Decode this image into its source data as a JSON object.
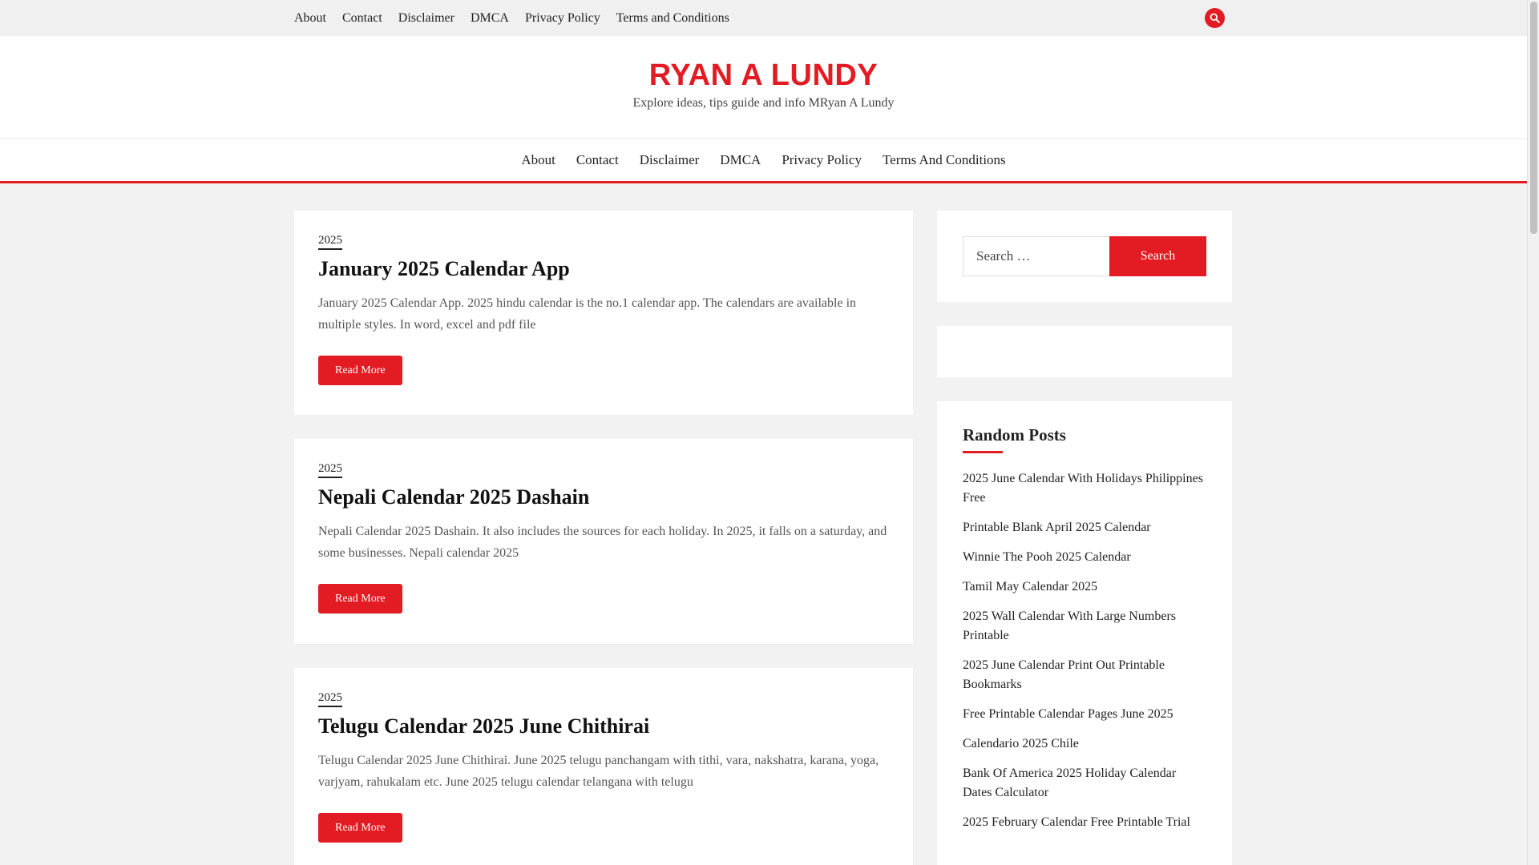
{
  "topbar": {
    "links": [
      "About",
      "Contact",
      "Disclaimer",
      "DMCA",
      "Privacy Policy",
      "Terms and Conditions"
    ],
    "search_icon": "search-icon"
  },
  "header": {
    "title": "RYAN A LUNDY",
    "description": "Explore ideas, tips guide and info MRyan A Lundy"
  },
  "mainnav": {
    "links": [
      "About",
      "Contact",
      "Disclaimer",
      "DMCA",
      "Privacy Policy",
      "Terms And Conditions"
    ]
  },
  "posts": [
    {
      "category": "2025",
      "title": "January 2025 Calendar App",
      "excerpt": "January 2025 Calendar App. 2025 hindu calendar is the no.1 calendar app. The calendars are available in multiple styles. In word, excel and pdf file",
      "read_more": "Read More"
    },
    {
      "category": "2025",
      "title": "Nepali Calendar 2025 Dashain",
      "excerpt": "Nepali Calendar 2025 Dashain. It also includes the sources for each holiday. In 2025, it falls on a saturday, and some businesses. Nepali calendar 2025",
      "read_more": "Read More"
    },
    {
      "category": "2025",
      "title": "Telugu Calendar 2025 June Chithirai",
      "excerpt": "Telugu Calendar 2025 June Chithirai. June 2025 telugu panchangam with tithi, vara, nakshatra, karana, yoga, varjyam, rahukalam etc. June 2025 telugu calendar telangana with telugu",
      "read_more": "Read More"
    }
  ],
  "sidebar": {
    "search": {
      "placeholder": "Search …",
      "button": "Search"
    },
    "random_posts": {
      "title": "Random Posts",
      "items": [
        "2025 June Calendar With Holidays Philippines Free",
        "Printable Blank April 2025 Calendar",
        "Winnie The Pooh 2025 Calendar",
        "Tamil May Calendar 2025",
        "2025 Wall Calendar With Large Numbers Printable",
        "2025 June Calendar Print Out Printable Bookmarks",
        "Free Printable Calendar Pages June 2025",
        "Calendario 2025 Chile",
        "Bank Of America 2025 Holiday Calendar Dates Calculator",
        "2025 February Calendar Free Printable Trial"
      ]
    }
  },
  "colors": {
    "accent": "#e31b23",
    "background": "#f2f2f2"
  }
}
